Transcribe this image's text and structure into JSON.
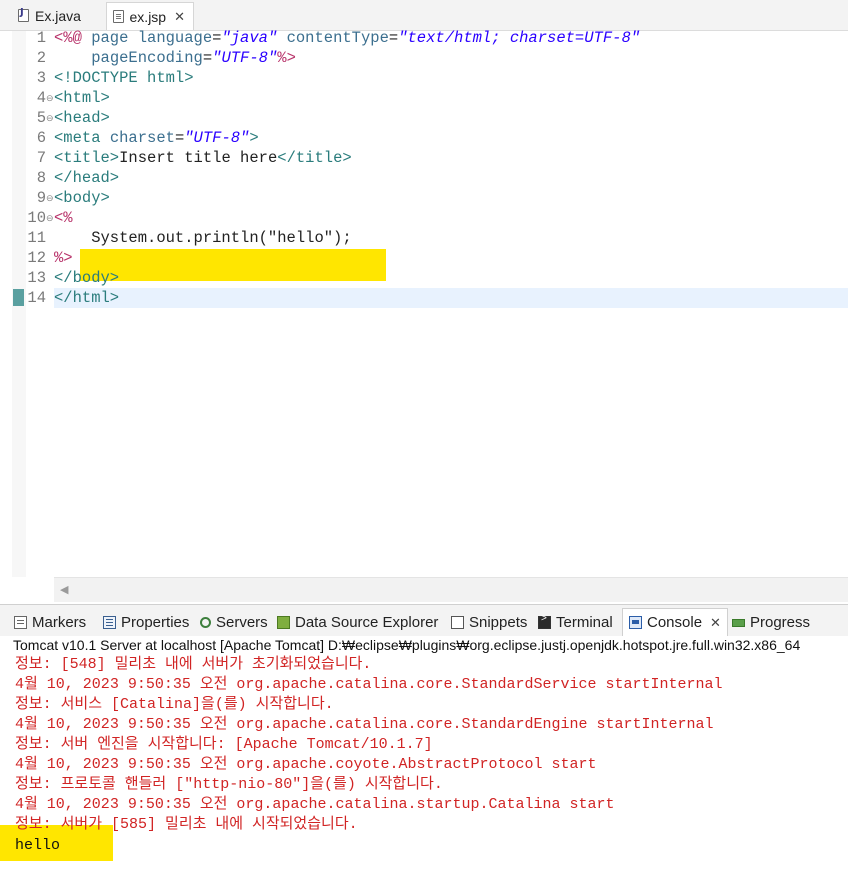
{
  "editor_tabs": [
    {
      "label": "Ex.java",
      "icon": "java-file-icon"
    },
    {
      "label": "ex.jsp",
      "icon": "jsp-file-icon",
      "close": "✕"
    }
  ],
  "code": {
    "line_numbers": [
      "1",
      "2",
      "3",
      "4",
      "5",
      "6",
      "7",
      "8",
      "9",
      "10",
      "11",
      "12",
      "13",
      "14"
    ],
    "l1": {
      "open": "<%@",
      "w1": " page ",
      "w2": "language",
      "eq": "=",
      "s1": "\"java\"",
      "w3": " contentType",
      "s2": "\"text/html; charset=UTF-8\""
    },
    "l2": {
      "indent": "    ",
      "w1": "pageEncoding",
      "eq": "=",
      "s1": "\"UTF-8\"",
      "close": "%>"
    },
    "l3": "<!DOCTYPE html>",
    "l4": "<html>",
    "l5": "<head>",
    "l6": {
      "t": "<meta ",
      "a": "charset",
      "eq": "=",
      "s": "\"UTF-8\"",
      "c": ">"
    },
    "l7": {
      "t1": "<title>",
      "txt": "Insert title here",
      "t2": "</title>"
    },
    "l8": "</head>",
    "l9": "<body>",
    "l10": "<%",
    "l11": "    System.out.println(\"hello\");",
    "l12": "%>",
    "l13": "</body>",
    "l14": "</html>"
  },
  "views_tabs": [
    {
      "label": "Markers",
      "icon": "markers-icon"
    },
    {
      "label": "Properties",
      "icon": "properties-icon"
    },
    {
      "label": "Servers",
      "icon": "servers-icon"
    },
    {
      "label": "Data Source Explorer",
      "icon": "data-source-explorer-icon"
    },
    {
      "label": "Snippets",
      "icon": "snippets-icon"
    },
    {
      "label": "Terminal",
      "icon": "terminal-icon"
    },
    {
      "label": "Console",
      "icon": "console-icon",
      "close": "✕",
      "active": true
    },
    {
      "label": "Progress",
      "icon": "progress-icon"
    }
  ],
  "console": {
    "header": "Tomcat v10.1 Server at localhost [Apache Tomcat] D:₩eclipse₩plugins₩org.eclipse.justj.openjdk.hotspot.jre.full.win32.x86_64",
    "lines": [
      "정보: [548] 밀리초 내에 서버가 초기화되었습니다.",
      "4월 10, 2023 9:50:35 오전 org.apache.catalina.core.StandardService startInternal",
      "정보: 서비스 [Catalina]을(를) 시작합니다.",
      "4월 10, 2023 9:50:35 오전 org.apache.catalina.core.StandardEngine startInternal",
      "정보: 서버 엔진을 시작합니다: [Apache Tomcat/10.1.7]",
      "4월 10, 2023 9:50:35 오전 org.apache.coyote.AbstractProtocol start",
      "정보: 프로토콜 핸들러 [\"http-nio-80\"]을(를) 시작합니다.",
      "4월 10, 2023 9:50:35 오전 org.apache.catalina.startup.Catalina start",
      "정보: 서버가 [585] 밀리초 내에 시작되었습니다."
    ],
    "output": "hello"
  },
  "colors": {
    "highlight": "#ffe600",
    "error_text": "#d12424",
    "current_line": "#e8f2fe"
  }
}
